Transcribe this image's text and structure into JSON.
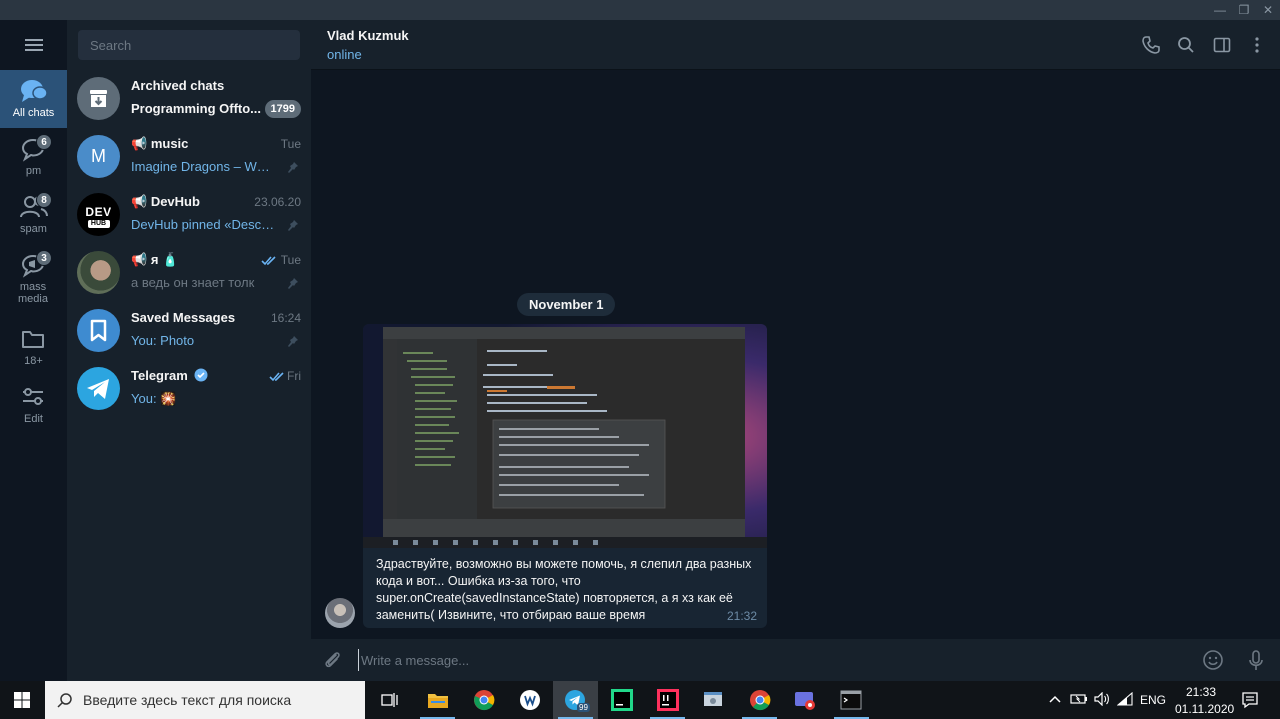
{
  "window": {
    "controls": [
      "—",
      "❐",
      "✕"
    ]
  },
  "folders": [
    {
      "label": "All chats",
      "badge": ""
    },
    {
      "label": "pm",
      "badge": "6"
    },
    {
      "label": "spam",
      "badge": "8"
    },
    {
      "label": "mass media",
      "badge": "3"
    },
    {
      "label": "18+",
      "badge": ""
    },
    {
      "label": "Edit",
      "badge": ""
    }
  ],
  "search": {
    "placeholder": "Search"
  },
  "chats": [
    {
      "name": "Archived chats",
      "message": "Programming Offto...",
      "time": "",
      "badge": "1799"
    },
    {
      "name": "music",
      "avatar_letter": "M",
      "message": "Imagine Dragons – What...",
      "time": "Tue"
    },
    {
      "name": "DevHub",
      "message": "DevHub pinned «Descrip...",
      "time": "23.06.20",
      "avatar_text": "DEV",
      "avatar_sub": "HUB"
    },
    {
      "name": "я",
      "message": "а ведь он знает толк",
      "time": "Tue"
    },
    {
      "name": "Saved Messages",
      "message": "You: Photo",
      "time": "16:24"
    },
    {
      "name": "Telegram",
      "message": "You: 🎇",
      "time": "Fri"
    }
  ],
  "header": {
    "name": "Vlad Kuzmuk",
    "status": "online"
  },
  "conversation": {
    "date": "November 1",
    "message": {
      "text": "Здраствуйте, возможно вы можете помочь, я слепил два разных кода и вот... Ошибка из-за того, что super.onCreate(savedInstanceState) повторяется, а я хз как её заменить( Извините, что отбираю ваше время",
      "time": "21:32"
    }
  },
  "compose": {
    "placeholder": "Write a message..."
  },
  "taskbar": {
    "search_placeholder": "Введите здесь текст для поиска",
    "telegram_badge": "99",
    "lang": "ENG",
    "time": "21:33",
    "date": "01.11.2020"
  },
  "colors": {
    "accent": "#2b5278",
    "link": "#71b5e8",
    "bg": "#0e1621",
    "panel": "#17212b"
  }
}
